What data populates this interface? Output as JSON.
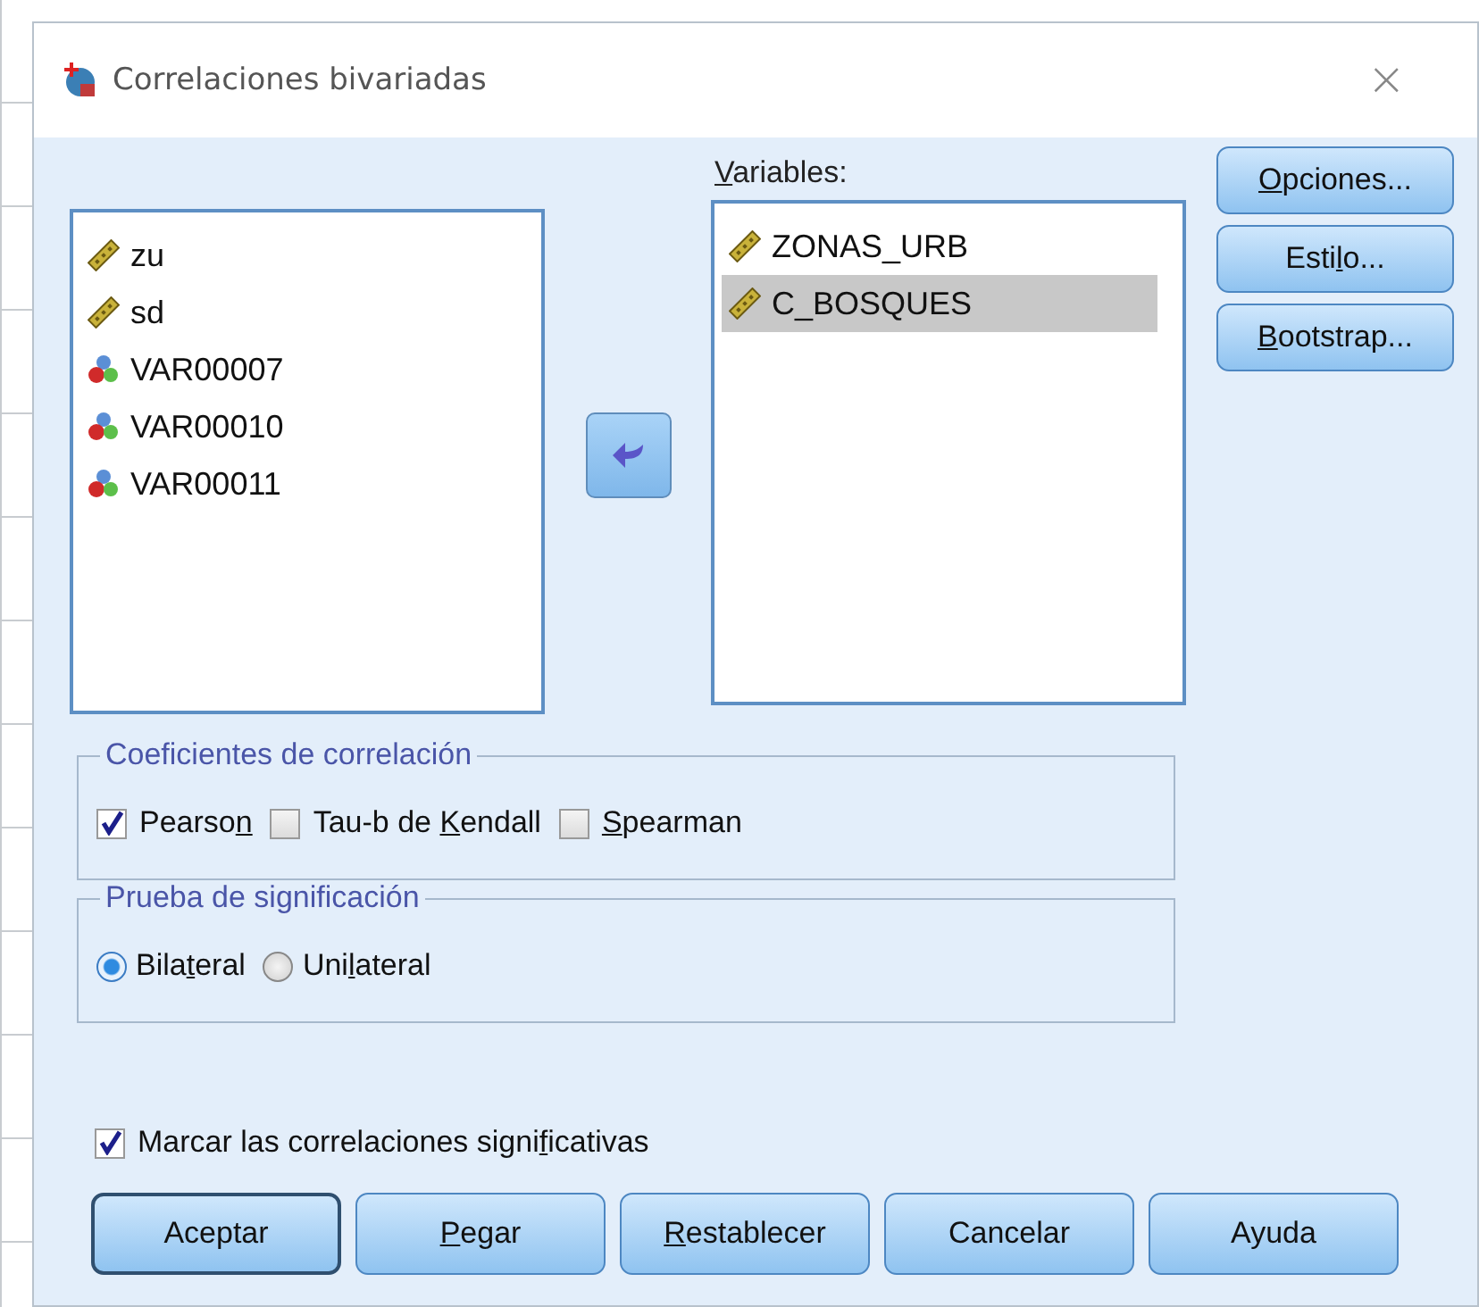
{
  "window": {
    "title": "Correlaciones bivariadas",
    "close": "×"
  },
  "source_list": {
    "items": [
      {
        "name": "zu",
        "kind": "scale",
        "selected": false
      },
      {
        "name": "sd",
        "kind": "scale",
        "selected": false
      },
      {
        "name": "VAR00007",
        "kind": "nominal",
        "selected": false
      },
      {
        "name": "VAR00010",
        "kind": "nominal",
        "selected": false
      },
      {
        "name": "VAR00011",
        "kind": "nominal",
        "selected": false
      }
    ]
  },
  "variables_list": {
    "label": {
      "key": "V",
      "after": "ariables:"
    },
    "items": [
      {
        "name": "ZONAS_URB",
        "kind": "scale",
        "selected": false
      },
      {
        "name": "C_BOSQUES",
        "kind": "scale",
        "selected": true
      }
    ]
  },
  "side_buttons": [
    {
      "label": {
        "key": "O",
        "after": "pciones..."
      }
    },
    {
      "label": {
        "before": "Esti",
        "key": "l",
        "after": "o..."
      }
    },
    {
      "label": {
        "key": "B",
        "after": "ootstrap..."
      }
    }
  ],
  "coefficients": {
    "title": "Coeficientes de correlación",
    "options": [
      {
        "label": {
          "before": "Pearso",
          "key": "n"
        },
        "checked": true
      },
      {
        "label": {
          "before": "Tau-b de ",
          "key": "K",
          "after": "endall"
        },
        "checked": false
      },
      {
        "label": {
          "key": "S",
          "after": "pearman"
        },
        "checked": false
      }
    ]
  },
  "significance": {
    "title": "Prueba de significación",
    "options": [
      {
        "label": {
          "before": "Bila",
          "key": "t",
          "after": "eral"
        },
        "selected": true
      },
      {
        "label": {
          "before": "Uni",
          "key": "l",
          "after": "ateral"
        },
        "selected": false
      }
    ]
  },
  "flag": {
    "label": {
      "before": "Marcar las correlaciones signi",
      "key": "f",
      "after": "icativas"
    },
    "checked": true
  },
  "buttons": [
    {
      "label": "Aceptar",
      "default": true
    },
    {
      "label": {
        "key": "P",
        "after": "egar"
      },
      "default": false
    },
    {
      "label": {
        "key": "R",
        "after": "establecer"
      },
      "default": false
    },
    {
      "label": "Cancelar",
      "default": false
    },
    {
      "label": "Ayuda",
      "default": false
    }
  ]
}
